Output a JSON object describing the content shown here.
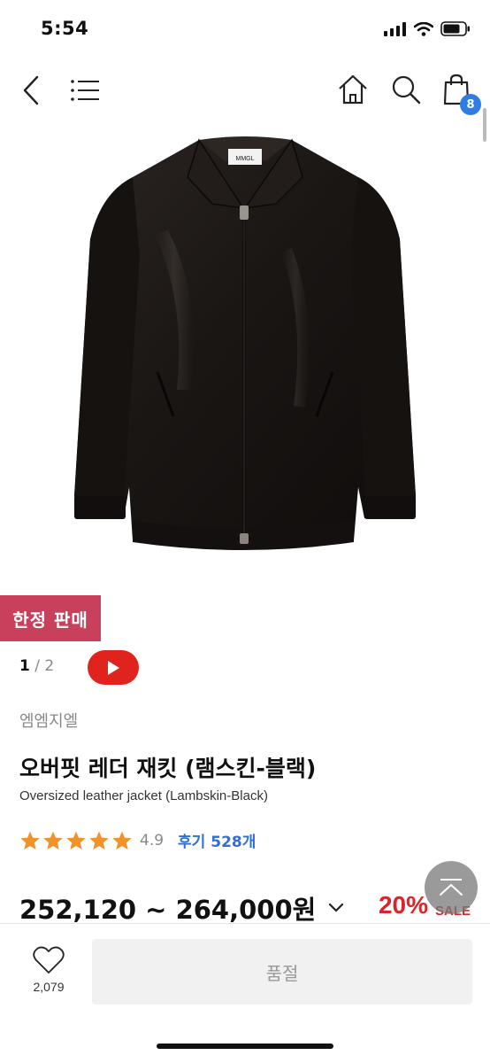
{
  "status_bar": {
    "time": "5:54"
  },
  "nav": {
    "cart_count": "8"
  },
  "product": {
    "badge": "한정 판매",
    "pager_current": "1",
    "pager_separator": "/",
    "pager_total": "2",
    "brand": "엠엠지엘",
    "title_ko": "오버핏 레더 재킷 (램스킨-블랙)",
    "title_en": "Oversized leather jacket (Lambskin-Black)",
    "image_label": "MMGL",
    "rating": "4.9",
    "stars": 5,
    "review_label": "후기 528개",
    "price": "252,120 ~ 264,000원",
    "discount": "20%",
    "sale_label": "SALE"
  },
  "bottom_bar": {
    "wish_count": "2,079",
    "soldout_label": "품절"
  },
  "colors": {
    "badge": "#c9405d",
    "video": "#e0231c",
    "accent_blue": "#2f7de1",
    "discount_red": "#d7262c",
    "star": "#f0932b"
  }
}
